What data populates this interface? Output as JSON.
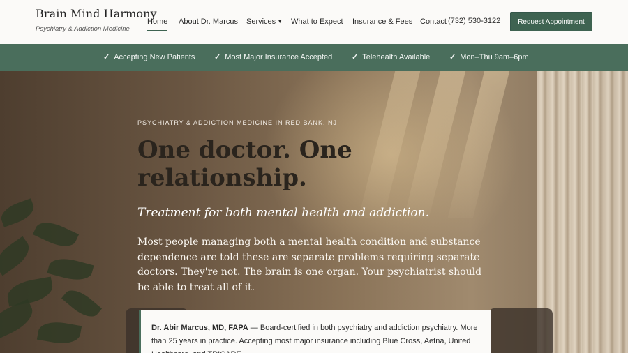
{
  "brand": {
    "name": "Brain Mind Harmony",
    "tagline": "Psychiatry & Addiction Medicine"
  },
  "nav": {
    "items": [
      {
        "label": "Home",
        "active": true
      },
      {
        "label": "About Dr. Marcus"
      },
      {
        "label": "Services",
        "has_dropdown": true
      },
      {
        "label": "What to Expect"
      },
      {
        "label": "Insurance & Fees"
      },
      {
        "label": "Contact"
      }
    ],
    "phone": "(732) 530-3122",
    "cta": "Request Appointment"
  },
  "trust_bar": {
    "items": [
      "Accepting New Patients",
      "Most Major Insurance Accepted",
      "Telehealth Available",
      "Mon–Thu 9am–6pm"
    ],
    "icon": "check-icon"
  },
  "hero": {
    "eyebrow": "PSYCHIATRY & ADDICTION MEDICINE IN RED BANK, NJ",
    "heading": "One doctor. One relationship.",
    "subheading": "Treatment for both mental health and addiction.",
    "body": "Most people managing both a mental health condition and substance dependence are told these are separate problems requiring separate doctors. They're not. The brain is one organ. Your psychiatrist should be able to treat all of it.",
    "card": {
      "name": "Dr. Abir Marcus, MD, FAPA",
      "text": " — Board-certified in both psychiatry and addiction psychiatry. More than 25 years in practice. Accepting most major insurance including Blue Cross, Aetna, United Healthcare, and TRICARE."
    }
  },
  "colors": {
    "accent": "#4a6e5c",
    "accent_dark": "#3e6351",
    "page_bg": "#fbfaf8"
  }
}
